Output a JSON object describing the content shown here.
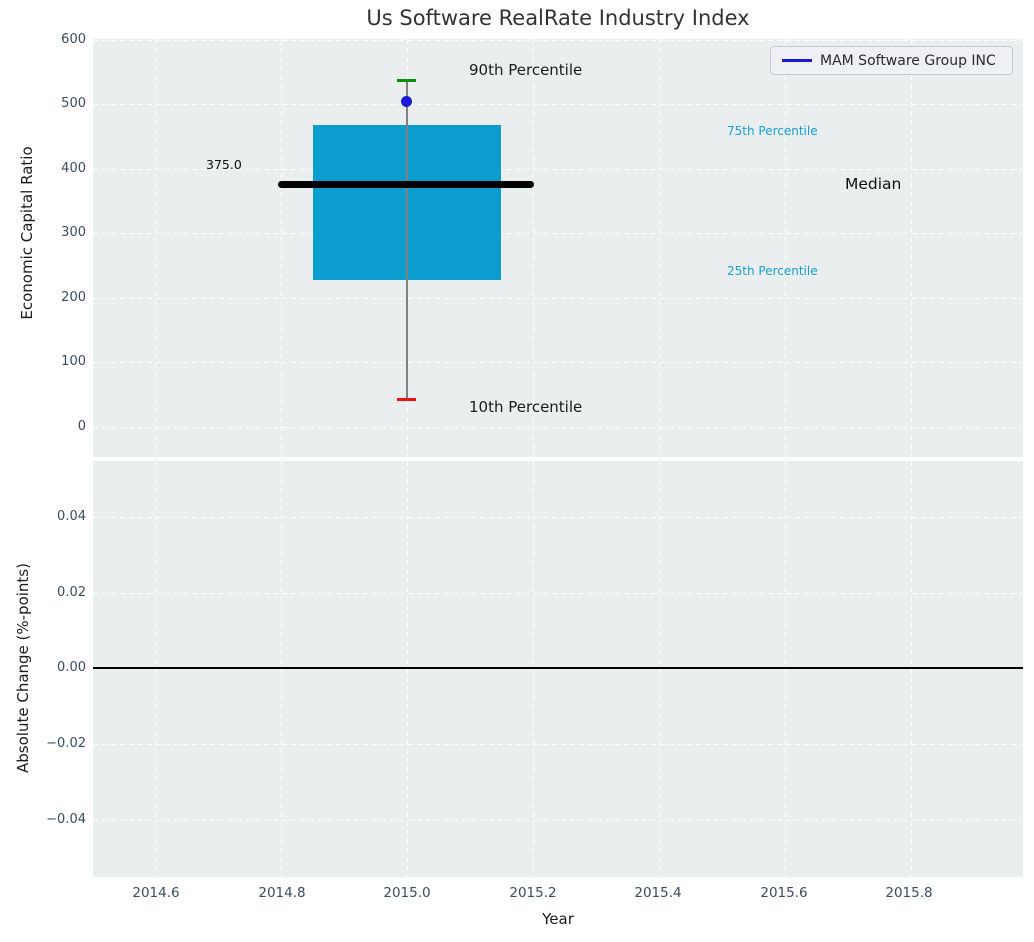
{
  "title": "Us Software RealRate Industry Index",
  "colors": {
    "plot_background": "#eaeeef",
    "grid": "#ffffff",
    "box_fill": "#0a9dce",
    "median_line": "#000000",
    "whisker": "#808080",
    "cap_90th": "#0a8f0a",
    "cap_10th": "#ee1111",
    "company_marker": "#1a1ad9",
    "percentile_label": "#16a0d4",
    "tick_label": "#3b4c5f"
  },
  "legend": {
    "label": "MAM Software Group INC"
  },
  "chart_data": [
    {
      "type": "boxplot",
      "title": "Us Software RealRate Industry Index",
      "ylabel": "Economic Capital Ratio",
      "ylim": [
        -46,
        600
      ],
      "xlim": [
        2014.5,
        2015.98
      ],
      "grid": true,
      "yticks": [
        600,
        500,
        400,
        300,
        200,
        100,
        0
      ],
      "ytick_labels": [
        "600",
        "500",
        "400",
        "300",
        "200",
        "100",
        "0"
      ],
      "box": {
        "x_center": 2015.0,
        "x_width": 0.3,
        "p10": 42,
        "p25": 228,
        "median": 375.0,
        "p75": 468,
        "p90": 537
      },
      "median_value_label": "375.0",
      "company_point": {
        "name": "MAM Software Group INC",
        "x": 2015.0,
        "y": 503
      },
      "legend_entries": [
        "MAM Software Group INC"
      ],
      "legend_position": "upper right",
      "annotations": [
        {
          "text": "90th Percentile",
          "x": 2015.2,
          "y": 550
        },
        {
          "text": "75th Percentile",
          "x": 2015.62,
          "y": 457
        },
        {
          "text": "Median",
          "x": 2015.74,
          "y": 375
        },
        {
          "text": "25th Percentile",
          "x": 2015.62,
          "y": 240
        },
        {
          "text": "10th Percentile",
          "x": 2015.2,
          "y": 29
        }
      ]
    },
    {
      "type": "line",
      "ylabel": "Absolute Change (%-points)",
      "xlabel": "Year",
      "ylim": [
        -0.056,
        0.055
      ],
      "xlim": [
        2014.5,
        2015.98
      ],
      "grid": true,
      "yticks": [
        0.04,
        0.02,
        0.0,
        -0.02,
        -0.04
      ],
      "ytick_labels": [
        "0.04",
        "0.02",
        "0.00",
        "−0.02",
        "−0.04"
      ],
      "xticks": [
        2014.6,
        2014.8,
        2015.0,
        2015.2,
        2015.4,
        2015.6,
        2015.8
      ],
      "xtick_labels": [
        "2014.6",
        "2014.8",
        "2015.0",
        "2015.2",
        "2015.4",
        "2015.6",
        "2015.8"
      ],
      "zero_line_y": 0.0
    }
  ]
}
